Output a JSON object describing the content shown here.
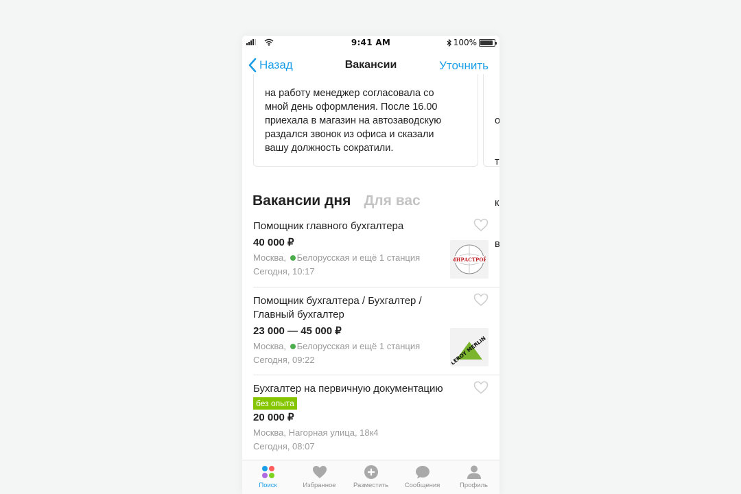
{
  "status_bar": {
    "time": "9:41 AM",
    "battery": "100%"
  },
  "nav": {
    "back_label": "Назад",
    "title": "Вакансии",
    "refine_label": "Уточнить"
  },
  "review": {
    "lines": [
      "на работу менеджер согласовала со",
      "мной день оформления. После 16.00",
      "приехала в магазин на автозаводскую",
      "раздался звонок из офиса и сказали",
      "вашу должность сократили."
    ],
    "next_card_fragment": [
      "о",
      "т",
      "к",
      "в"
    ]
  },
  "section_tabs": {
    "active": "Вакансии дня",
    "inactive": "Для вас"
  },
  "vacancies": [
    {
      "title": "Помощник главного бухгалтера",
      "salary": "40 000 ₽",
      "city": "Москва,",
      "metro": "Белорусская и ещё 1 станция",
      "date": "Сегодня, 10:17",
      "logo_text": "МИРАСТРОЙ"
    },
    {
      "title_line1": "Помощник бухгалтера / Бухгалтер /",
      "title_line2": "Главный бухгалтер",
      "salary": "23 000 — 45 000 ₽",
      "city": "Москва,",
      "metro": "Белорусская и ещё 1 станция",
      "date": "Сегодня, 09:22",
      "logo_text": "LEROY MERLIN"
    },
    {
      "title": "Бухгалтер на первичную документацию",
      "badge": "без опыта",
      "salary": "20 000 ₽",
      "address": "Москва, Нагорная улица, 18к4",
      "date": "Сегодня, 08:07"
    }
  ],
  "tabbar": [
    {
      "label": "Поиск",
      "icon": "search-dots-icon",
      "active": true
    },
    {
      "label": "Избранное",
      "icon": "heart-icon",
      "active": false
    },
    {
      "label": "Разместить",
      "icon": "plus-circle-icon",
      "active": false
    },
    {
      "label": "Сообщения",
      "icon": "chat-bubble-icon",
      "active": false
    },
    {
      "label": "Профиль",
      "icon": "person-icon",
      "active": false
    }
  ],
  "colors": {
    "accent": "#1a9ee8",
    "badge": "#85c600",
    "metro": "#4cae4c"
  }
}
